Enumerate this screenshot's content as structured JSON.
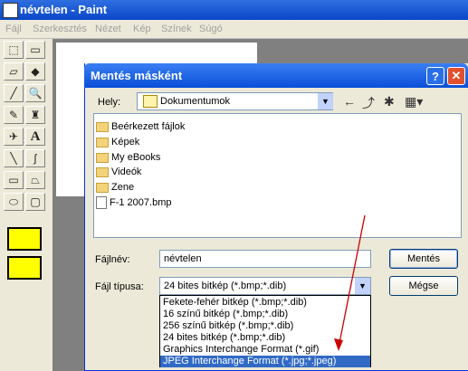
{
  "paint": {
    "title": "névtelen - Paint",
    "menu": [
      "Fájl",
      "Szerkesztés",
      "Nézet",
      "Kép",
      "Színek",
      "Súgó"
    ]
  },
  "dialog": {
    "title": "Mentés másként",
    "help_label": "?",
    "close_label": "✕",
    "location_label": "Hely:",
    "location_value": "Dokumentumok",
    "files": [
      {
        "name": "Beérkezett fájlok",
        "type": "folder"
      },
      {
        "name": "Képek",
        "type": "folder"
      },
      {
        "name": "My eBooks",
        "type": "folder"
      },
      {
        "name": "Videók",
        "type": "folder"
      },
      {
        "name": "Zene",
        "type": "folder"
      },
      {
        "name": "F-1 2007.bmp",
        "type": "bmp"
      }
    ],
    "filename_label": "Fájlnév:",
    "filename_value": "névtelen",
    "filetype_label": "Fájl típusa:",
    "filetype_value": "24 bites bitkép (*.bmp;*.dib)",
    "save_label": "Mentés",
    "cancel_label": "Mégse",
    "filetype_options": [
      "Fekete-fehér bitkép (*.bmp;*.dib)",
      "16 színű bitkép (*.bmp;*.dib)",
      "256 színű bitkép (*.bmp;*.dib)",
      "24 bites bitkép (*.bmp;*.dib)",
      "Graphics Interchange Format (*.gif)",
      "JPEG Interchange Format (*.jpg;*.jpeg)"
    ],
    "selected_option_index": 5
  },
  "colors": {
    "titlebar": "#0a46c9",
    "selection": "#316ac5",
    "annotation_arrow": "#cc0000"
  }
}
